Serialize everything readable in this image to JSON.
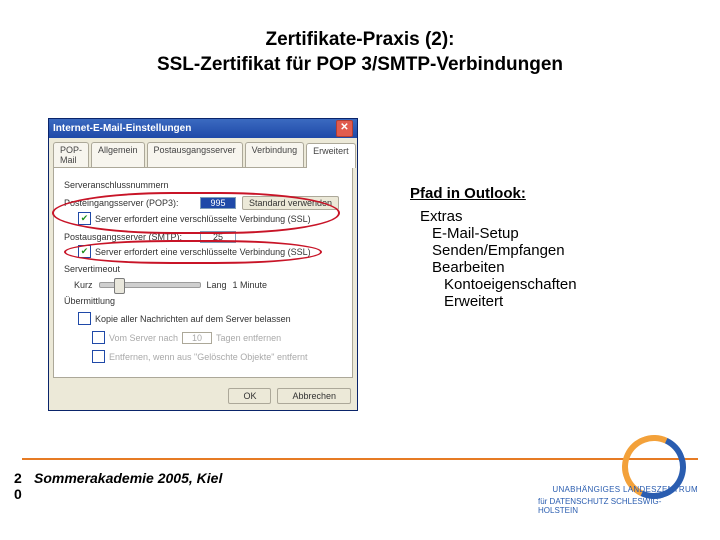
{
  "title_line1": "Zertifikate-Praxis (2):",
  "title_line2": "SSL-Zertifikat für POP 3/SMTP-Verbindungen",
  "path": {
    "heading": "Pfad in Outlook:",
    "items": [
      "Extras",
      "E-Mail-Setup",
      "Senden/Empfangen",
      "Bearbeiten",
      "Kontoeigenschaften",
      "Erweitert"
    ]
  },
  "dialog": {
    "title": "Internet-E-Mail-Einstellungen",
    "tabs": [
      "POP-Mail",
      "Allgemein",
      "Postausgangsserver",
      "Verbindung",
      "Erweitert"
    ],
    "group_ports": "Serveranschlussnummern",
    "pop_label": "Posteingangsserver (POP3):",
    "pop_port": "995",
    "std_btn": "Standard verwenden",
    "ssl_in": "Server erfordert eine verschlüsselte Verbindung (SSL)",
    "smtp_label": "Postausgangsserver (SMTP):",
    "smtp_port": "25",
    "ssl_out": "Server erfordert eine verschlüsselte Verbindung (SSL)",
    "group_timeout": "Servertimeout",
    "short": "Kurz",
    "long": "Lang",
    "timeout_val": "1 Minute",
    "group_delivery": "Übermittlung",
    "leave_copy": "Kopie aller Nachrichten auf dem Server belassen",
    "remove_after": "Vom Server nach",
    "days_val": "10",
    "days_lbl": "Tagen entfernen",
    "remove_deleted": "Entfernen, wenn aus \"Gelöschte Objekte\" entfernt",
    "ok": "OK",
    "cancel": "Abbrechen"
  },
  "footer": {
    "page": "2\n0",
    "text": "Sommerakademie 2005, Kiel"
  },
  "brand": {
    "l1": "UNABHÄNGIGES LANDESZENTRUM",
    "l2": "für DATENSCHUTZ SCHLESWIG-HOLSTEIN"
  }
}
